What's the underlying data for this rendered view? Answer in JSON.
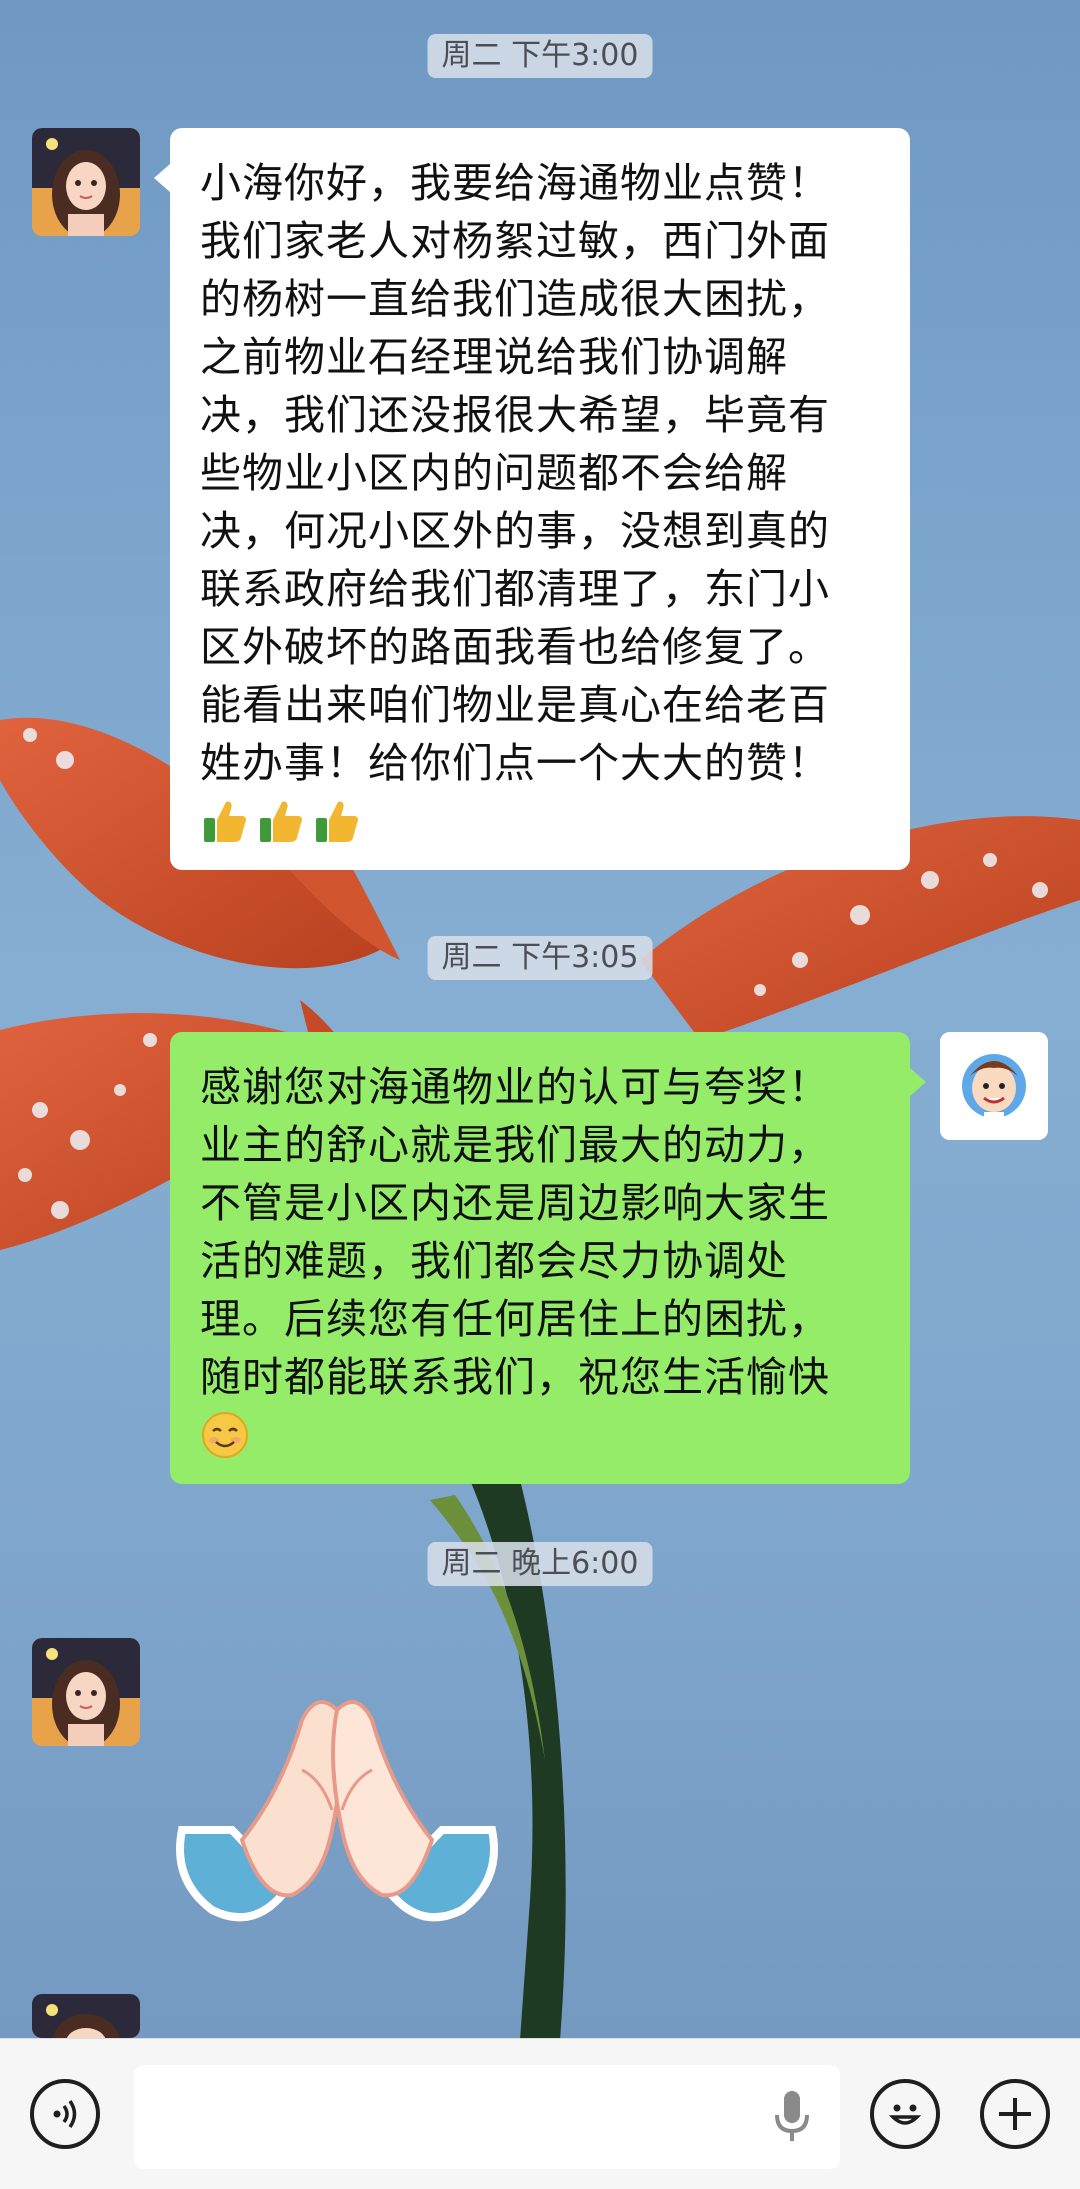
{
  "messages": [
    {
      "timestamp": "周二 下午3:00",
      "side": "left",
      "lines": [
        "小海你好，我要给海通物业点赞！",
        "我们家老人对杨絮过敏，西门外面",
        "的杨树一直给我们造成很大困扰，",
        "之前物业石经理说给我们协调解",
        "决，我们还没报很大希望，毕竟有",
        "些物业小区内的问题都不会给解",
        "决，何况小区外的事，没想到真的",
        "联系政府给我们都清理了，东门小",
        "区外破坏的路面我看也给修复了。",
        "能看出来咱们物业是真心在给老百",
        "姓办事！给你们点一个大大的赞！"
      ],
      "emojis": [
        "thumbs-up-icon",
        "thumbs-up-icon",
        "thumbs-up-icon"
      ]
    },
    {
      "timestamp": "周二 下午3:05",
      "side": "right",
      "lines": [
        "感谢您对海通物业的认可与夸奖！",
        "业主的舒心就是我们最大的动力，",
        "不管是小区内还是周边影响大家生",
        "活的难题，我们都会尽力协调处",
        "理。后续您有任何居住上的困扰，",
        "随时都能联系我们，祝您生活愉快"
      ],
      "emojis": [
        "smile-icon"
      ]
    },
    {
      "timestamp": "周二 晚上6:00",
      "side": "left",
      "sticker": "praying-hands-sticker"
    }
  ],
  "input": {
    "value": "",
    "placeholder": ""
  },
  "colors": {
    "incoming": "#ffffff",
    "outgoing": "#95ec69",
    "wallpaper": "#7aa3cb"
  }
}
